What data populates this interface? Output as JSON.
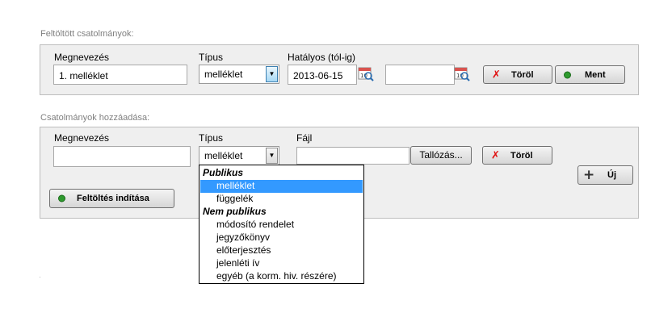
{
  "uploaded": {
    "section_label": "Feltöltött csatolmányok:",
    "name_label": "Megnevezés",
    "type_label": "Típus",
    "valid_label": "Hatályos (tól-ig)",
    "name_value": "1. melléklet",
    "type_value": "melléklet",
    "date_from": "2013-06-15",
    "date_to": "",
    "delete_label": "Töröl",
    "save_label": "Ment"
  },
  "add": {
    "section_label": "Csatolmányok hozzáadása:",
    "name_label": "Megnevezés",
    "type_label": "Típus",
    "file_label": "Fájl",
    "name_value": "",
    "type_value": "melléklet",
    "file_value": "",
    "browse_label": "Tallózás...",
    "delete_label": "Töröl",
    "new_label": "Új",
    "upload_label": "Feltöltés indítása"
  },
  "dropdown": {
    "group_public": "Publikus",
    "opt_melleklet": "melléklet",
    "opt_fuggelek": "függelék",
    "group_nonpublic": "Nem publikus",
    "opt_modosito": "módosító rendelet",
    "opt_jegyzokonyv": "jegyzőkönyv",
    "opt_eloterjesztes": "előterjesztés",
    "opt_jelenleti": "jelenléti ív",
    "opt_egyeb": "egyéb (a korm. hiv. részére)"
  },
  "icons": {
    "calendar": "calendar-search-icon",
    "delete": "x-icon",
    "save": "green-dot-icon",
    "add": "plus-icon",
    "dropdown_arrow": "chevron-down-icon"
  },
  "colors": {
    "panel_bg": "#efefef",
    "selected_option": "#3399ff",
    "delete_icon": "#e01010",
    "status_dot": "#2e9a2e"
  }
}
